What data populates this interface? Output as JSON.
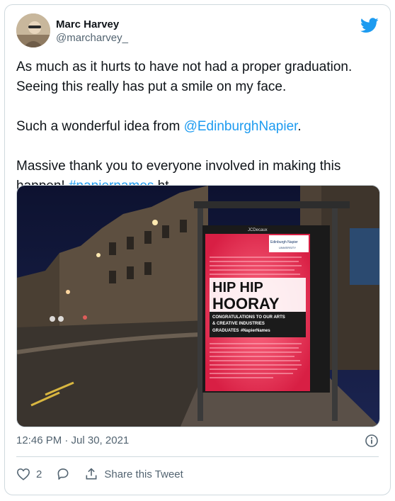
{
  "author": {
    "display_name": "Marc Harvey",
    "handle": "@marcharvey_"
  },
  "tweet": {
    "line1": "As much as it hurts to have not had a proper graduation.",
    "line2": "Seeing this really has put a smile on my face.",
    "line3_prefix": "Such a wonderful idea from ",
    "line3_mention": "@EdinburghNapier",
    "line3_suffix": ".",
    "line4": "Massive thank you to everyone involved in making this",
    "line5_prefix": "happen! ",
    "line5_hashtag": "#napiernames",
    "line5_suffix": " ht"
  },
  "image": {
    "brand": "JCDecaux",
    "logo_line1": "Edinburgh Napier",
    "logo_line2": "UNIVERSITY",
    "headline1": "HIP HIP",
    "headline2": "HOORAY",
    "sub1": "CONGRATULATIONS TO OUR ARTS",
    "sub2": "& CREATIVE INDUSTRIES",
    "sub3": "GRADUATES",
    "sub_tag": "#NapierNames"
  },
  "meta": {
    "timestamp": "12:46 PM · Jul 30, 2021"
  },
  "actions": {
    "like_count": "2",
    "share_label": "Share this Tweet"
  },
  "colors": {
    "link": "#1d9bf0",
    "twitter_blue": "#1d9bf0",
    "poster_red": "#e5364e"
  },
  "icons": [
    "twitter-bird-icon",
    "info-icon",
    "heart-icon",
    "reply-icon",
    "share-icon"
  ]
}
